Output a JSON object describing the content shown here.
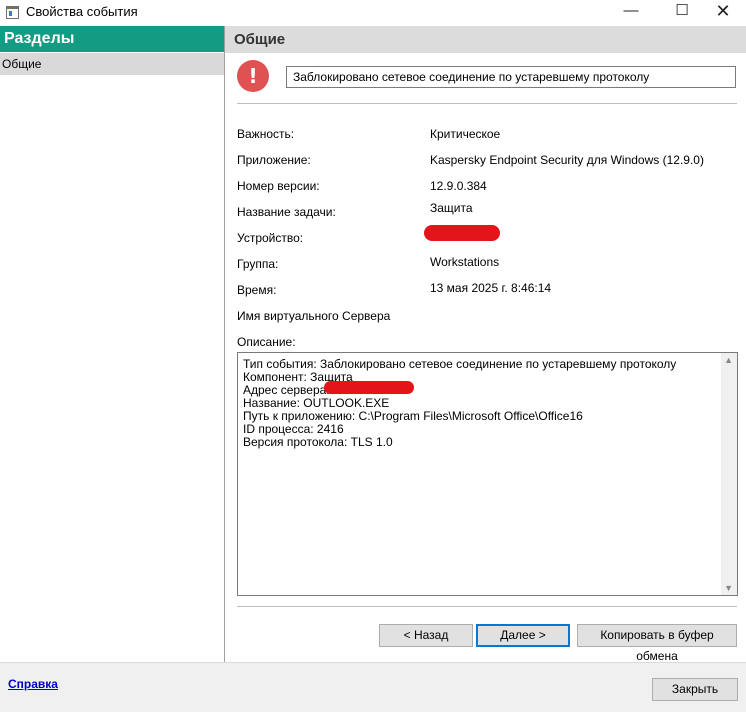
{
  "window": {
    "title": "Свойства события",
    "minimize_glyph": "—",
    "maximize_glyph": "☐",
    "close_glyph": "✕"
  },
  "sidebar": {
    "header": "Разделы",
    "items": [
      {
        "label": "Общие"
      }
    ]
  },
  "main": {
    "header": "Общие",
    "event_title": "Заблокировано сетевое соединение по устаревшему протоколу",
    "icon_glyph": "!",
    "fields": [
      {
        "label": "Важность:",
        "value": "Критическое"
      },
      {
        "label": "Приложение:",
        "value": "Kaspersky Endpoint Security для Windows (12.9.0)"
      },
      {
        "label": "Номер версии:",
        "value": "12.9.0.384"
      },
      {
        "label": "Название задачи:",
        "value": "Защита"
      },
      {
        "label": "Устройство:",
        "value": ""
      },
      {
        "label": "Группа:",
        "value": "Workstations"
      },
      {
        "label": "Время:",
        "value": "13 мая 2025 г. 8:46:14"
      },
      {
        "label": "Имя виртуального Сервера",
        "value": ""
      }
    ],
    "description_label": "Описание:",
    "description_lines": [
      "Тип события: Заблокировано сетевое соединение по устаревшему протоколу",
      "Компонент: Защита",
      "Адрес сервера:",
      "Название: OUTLOOK.EXE",
      "Путь к приложению: C:\\Program Files\\Microsoft Office\\Office16",
      "ID процесса: 2416",
      "Версия протокола: TLS 1.0"
    ]
  },
  "buttons": {
    "back": "< Назад",
    "next": "Далее >",
    "copy": "Копировать в буфер обмена",
    "close": "Закрыть"
  },
  "footer": {
    "help_link": "Справка"
  },
  "colors": {
    "sidebar_header_bg": "#139b84",
    "warning_icon": "#e05252",
    "redaction": "#e3151a",
    "link": "#0000cc"
  }
}
